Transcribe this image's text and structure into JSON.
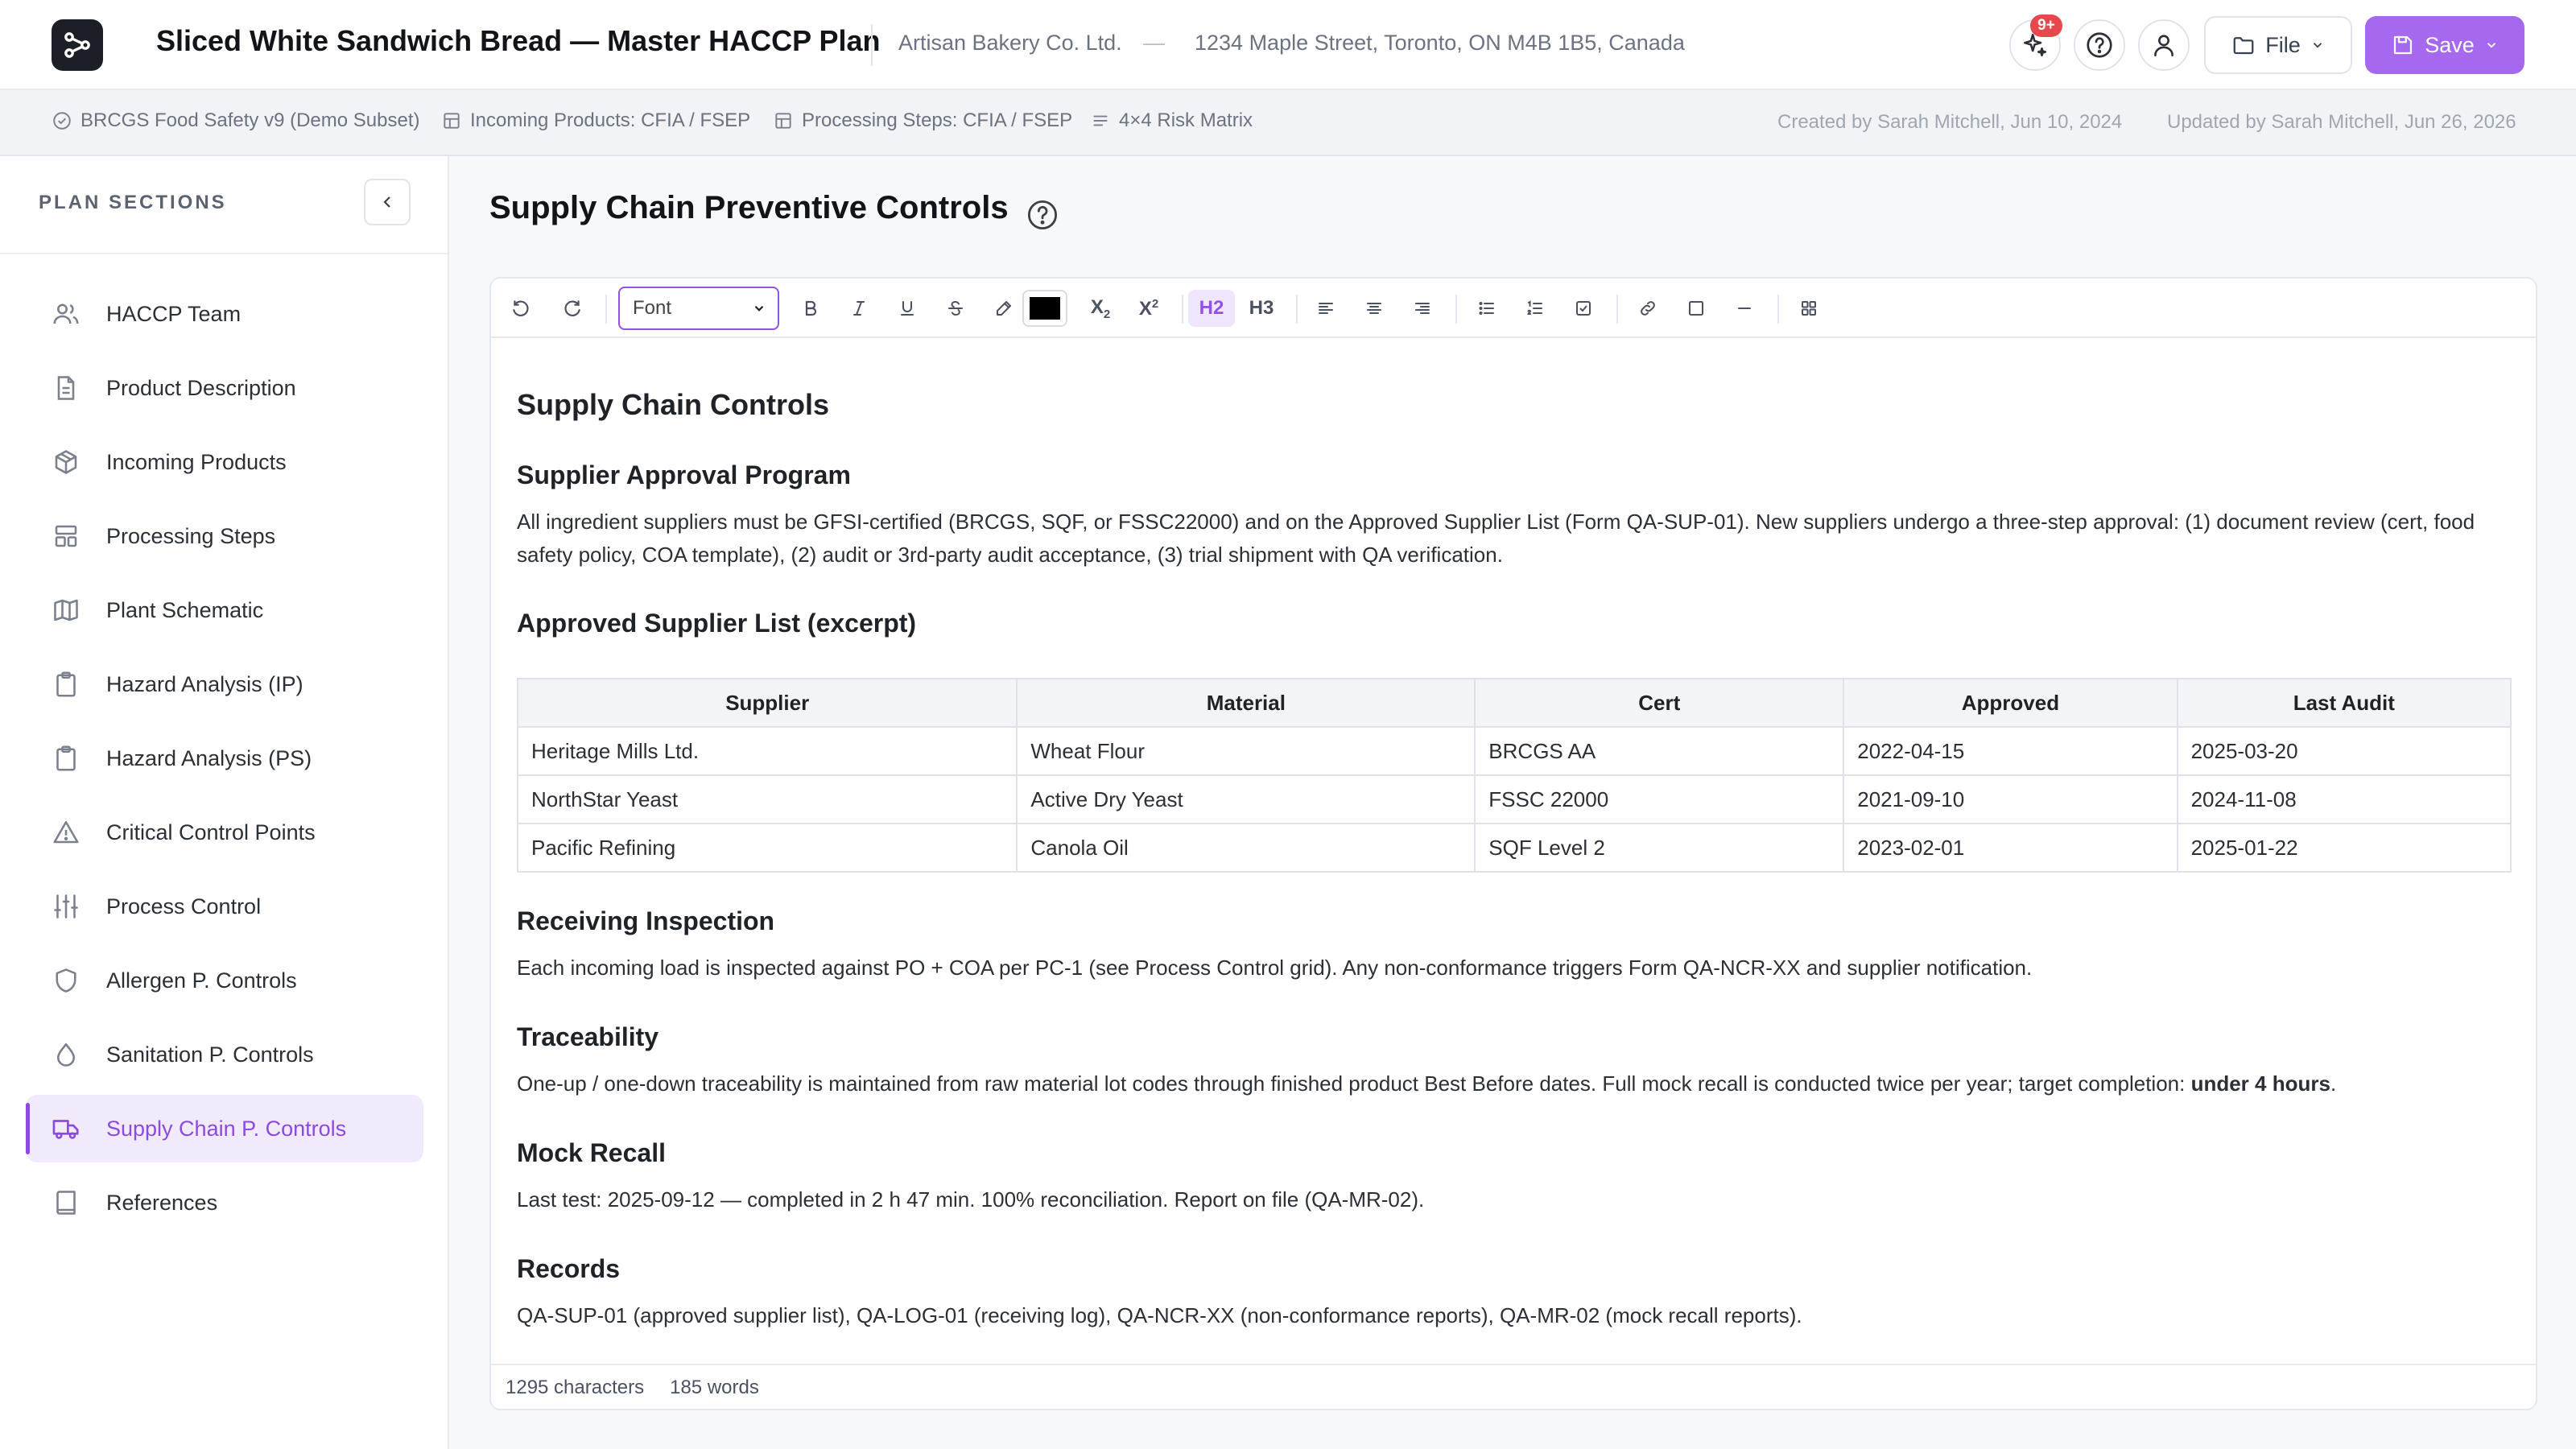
{
  "header": {
    "title": "Sliced White Sandwich Bread — Master HACCP Plan",
    "company": "Artisan Bakery Co. Ltd.",
    "separator": "—",
    "address": "1234 Maple Street, Toronto, ON M4B 1B5, Canada",
    "notification_badge": "9+",
    "file_label": "File",
    "save_label": "Save",
    "accent_color": "#a568ee"
  },
  "meta": {
    "standard": "BRCGS Food Safety v9 (Demo Subset)",
    "incoming": "Incoming Products: CFIA / FSEP",
    "processing": "Processing Steps: CFIA / FSEP",
    "matrix": "4×4 Risk Matrix",
    "created": "Created by Sarah Mitchell, Jun 10, 2024",
    "updated": "Updated by Sarah Mitchell, Jun 26, 2026"
  },
  "sidebar": {
    "heading": "PLAN SECTIONS",
    "items": [
      {
        "label": "HACCP Team",
        "icon": "users-icon"
      },
      {
        "label": "Product Description",
        "icon": "document-icon"
      },
      {
        "label": "Incoming Products",
        "icon": "box-icon"
      },
      {
        "label": "Processing Steps",
        "icon": "steps-icon"
      },
      {
        "label": "Plant Schematic",
        "icon": "map-icon"
      },
      {
        "label": "Hazard Analysis (IP)",
        "icon": "clipboard-icon"
      },
      {
        "label": "Hazard Analysis (PS)",
        "icon": "clipboard-icon"
      },
      {
        "label": "Critical Control Points",
        "icon": "warning-icon"
      },
      {
        "label": "Process Control",
        "icon": "sliders-icon"
      },
      {
        "label": "Allergen P. Controls",
        "icon": "shield-icon"
      },
      {
        "label": "Sanitation P. Controls",
        "icon": "droplet-icon"
      },
      {
        "label": "Supply Chain P. Controls",
        "icon": "truck-icon",
        "active": true
      },
      {
        "label": "References",
        "icon": "book-icon"
      }
    ]
  },
  "main": {
    "page_title": "Supply Chain Preventive Controls",
    "toolbar": {
      "font_label": "Font",
      "h2": "H2",
      "h3": "H3",
      "subscript": "X",
      "superscript": "X"
    },
    "doc": {
      "heading": "Supply Chain Controls",
      "supplier_approval_title": "Supplier Approval Program",
      "supplier_approval_text": "All ingredient suppliers must be GFSI-certified (BRCGS, SQF, or FSSC22000) and on the Approved Supplier List (Form QA-SUP-01). New suppliers undergo a three-step approval: (1) document review (cert, food safety policy, COA template), (2) audit or 3rd-party audit acceptance, (3) trial shipment with QA verification.",
      "asl_title": "Approved Supplier List (excerpt)",
      "table_headers": [
        "Supplier",
        "Material",
        "Cert",
        "Approved",
        "Last Audit"
      ],
      "table_rows": [
        [
          "Heritage Mills Ltd.",
          "Wheat Flour",
          "BRCGS AA",
          "2022-04-15",
          "2025-03-20"
        ],
        [
          "NorthStar Yeast",
          "Active Dry Yeast",
          "FSSC 22000",
          "2021-09-10",
          "2024-11-08"
        ],
        [
          "Pacific Refining",
          "Canola Oil",
          "SQF Level 2",
          "2023-02-01",
          "2025-01-22"
        ]
      ],
      "receiving_title": "Receiving Inspection",
      "receiving_text": "Each incoming load is inspected against PO + COA per PC-1 (see Process Control grid). Any non-conformance triggers Form QA-NCR-XX and supplier notification.",
      "trace_title": "Traceability",
      "trace_text": "One-up / one-down traceability is maintained from raw material lot codes through finished product Best Before dates. Full mock recall is conducted twice per year; target completion: ",
      "trace_bold": "under 4 hours",
      "trace_end": ".",
      "mock_title": "Mock Recall",
      "mock_text": "Last test: 2025-09-12 — completed in 2 h 47 min. 100% reconciliation. Report on file (QA-MR-02).",
      "records_title": "Records",
      "records_text": "QA-SUP-01 (approved supplier list), QA-LOG-01 (receiving log), QA-NCR-XX (non-conformance reports), QA-MR-02 (mock recall reports)."
    },
    "status": {
      "characters": "1295 characters",
      "words": "185 words"
    }
  }
}
